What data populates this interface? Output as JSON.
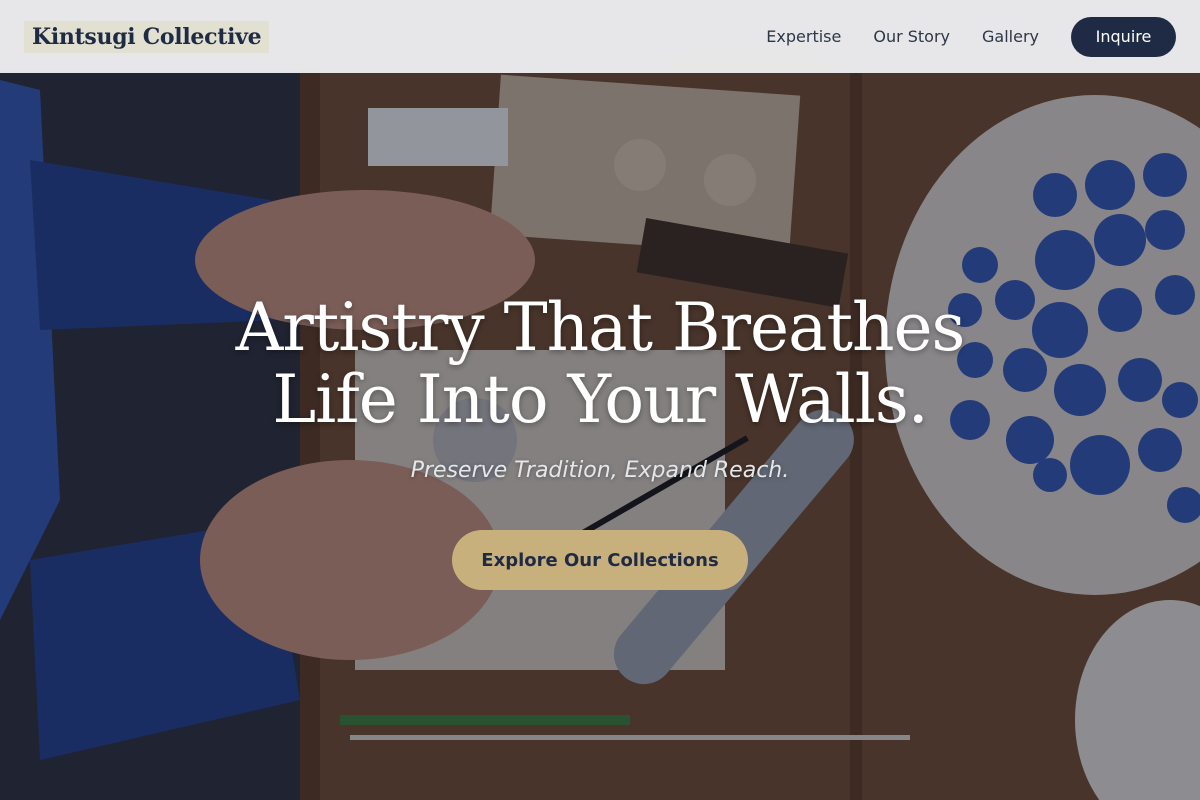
{
  "header": {
    "logo": "Kintsugi Collective",
    "nav": [
      {
        "label": "Expertise"
      },
      {
        "label": "Our Story"
      },
      {
        "label": "Gallery"
      }
    ],
    "inquire_label": "Inquire"
  },
  "hero": {
    "headline_line1": "Artistry That Breathes",
    "headline_line2": "Life Into Your Walls.",
    "tagline": "Preserve Tradition, Expand Reach.",
    "cta_label": "Explore Our Collections"
  },
  "colors": {
    "navy": "#1f2a44",
    "gold": "#c8b07c",
    "header_bg": "#f3f4f6",
    "clay_blue": "#2f55b8"
  }
}
